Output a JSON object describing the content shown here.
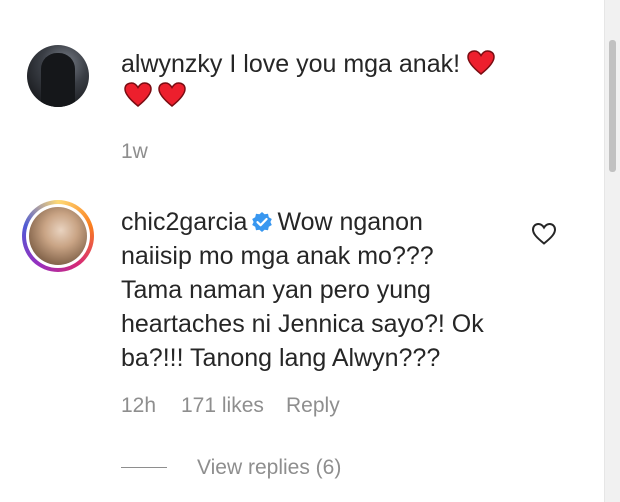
{
  "comment1": {
    "username": "alwynzky",
    "text": "I love you mga anak!",
    "time": "1w",
    "emoji_icon": "red-heart-emoji",
    "heart_color": "#ed1f2d"
  },
  "comment2": {
    "username": "chic2garcia",
    "verified_icon": "verified-badge-icon",
    "verified_color": "#3897f0",
    "lines": [
      "Wow nganon",
      "naiisip mo mga anak mo???",
      "Tama naman yan pero yung",
      "heartaches ni Jennica sayo?! Ok",
      "ba?!!! Tanong lang Alwyn???"
    ],
    "time": "12h",
    "likes": "171 likes",
    "reply_label": "Reply",
    "like_icon": "heart-outline-icon"
  },
  "view_replies": "View replies (6)"
}
